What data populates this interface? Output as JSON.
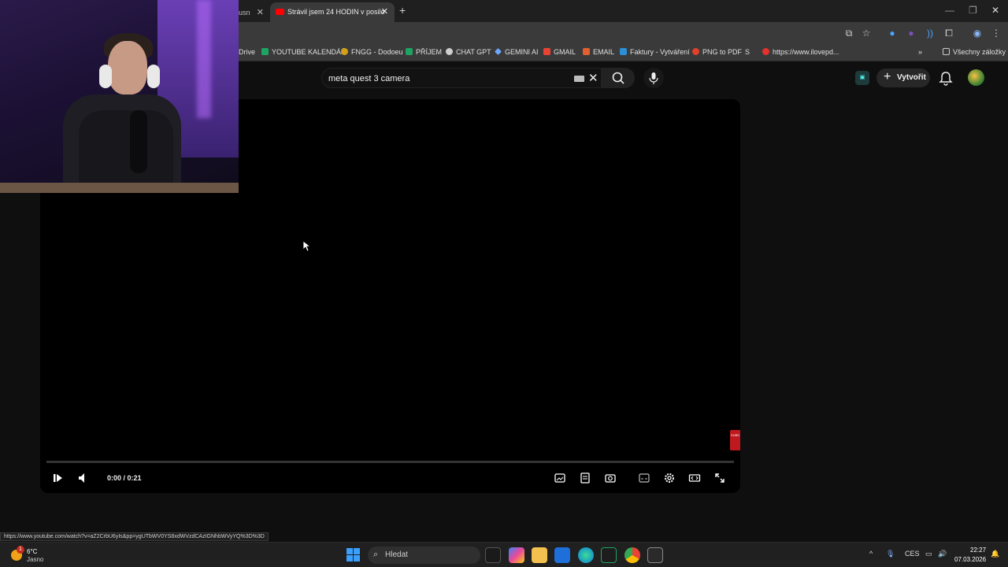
{
  "browser": {
    "prev_tab_title": "usn",
    "active_tab_title": "Strávil jsem 24 HODIN v posilo",
    "new_tab_label": "+"
  },
  "bookmarks": [
    {
      "label": "Drive",
      "color": "transparent"
    },
    {
      "label": "YOUTUBE KALENDÁŘ",
      "color": "#1ea362"
    },
    {
      "label": "FNGG - Dodoeu",
      "color": "#d4a017"
    },
    {
      "label": "PŘÍJEM",
      "color": "#1ea362"
    },
    {
      "label": "CHAT GPT",
      "color": "#cfcfcf"
    },
    {
      "label": "GEMINI AI",
      "color": "#6ea8fe"
    },
    {
      "label": "GMAIL",
      "color": "#ea4335"
    },
    {
      "label": "EMAIL",
      "color": "#e06030"
    },
    {
      "label": "Faktury - Vytváření",
      "color": "#2b8fd6"
    },
    {
      "label": "PNG to PDF",
      "color": "#e2402a"
    },
    {
      "label": "S",
      "color": "transparent"
    },
    {
      "label": "https://www.ilovepd...",
      "color": "#e5322d"
    }
  ],
  "bookmarks_overflow": "»",
  "bookmarks_folder": "Všechny záložky",
  "youtube": {
    "search_value": "meta quest 3 camera",
    "create_label": "Vytvořit"
  },
  "player": {
    "time": "0:00 / 0:21"
  },
  "status_url": "https://www.youtube.com/watch?v=aZ2CrbU6yIs&pp=ygUTbWV0YS8xdWVzdCAzIGNhbWVyYQ%3D%3D",
  "taskbar": {
    "weather_badge": "1",
    "temperature": "6°C",
    "weather_desc": "Jasno",
    "search_placeholder": "Hledat",
    "language": "CES",
    "time": "22:27",
    "date": "07.03.2026"
  }
}
